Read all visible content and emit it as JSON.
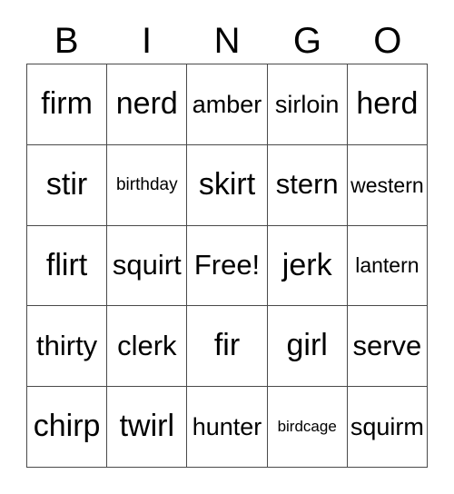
{
  "card": {
    "title": "BINGO",
    "header_letters": [
      "B",
      "I",
      "N",
      "G",
      "O"
    ],
    "free_space_label": "Free!",
    "colors": {
      "background": "#ffffff",
      "text": "#000000",
      "grid_line": "#4a4a4a"
    },
    "grid": {
      "columns": 5,
      "rows": 5,
      "cells": [
        [
          {
            "label": "firm",
            "size": "fs-xl"
          },
          {
            "label": "nerd",
            "size": "fs-xl"
          },
          {
            "label": "amber",
            "size": "fs-md"
          },
          {
            "label": "sirloin",
            "size": "fs-md"
          },
          {
            "label": "herd",
            "size": "fs-xl"
          }
        ],
        [
          {
            "label": "stir",
            "size": "fs-xl"
          },
          {
            "label": "birthday",
            "size": "fs-xs"
          },
          {
            "label": "skirt",
            "size": "fs-xl"
          },
          {
            "label": "stern",
            "size": "fs-lg"
          },
          {
            "label": "western",
            "size": "fs-sm"
          }
        ],
        [
          {
            "label": "flirt",
            "size": "fs-xl"
          },
          {
            "label": "squirt",
            "size": "fs-lg"
          },
          {
            "label": "Free!",
            "size": "fs-lg"
          },
          {
            "label": "jerk",
            "size": "fs-xl"
          },
          {
            "label": "lantern",
            "size": "fs-sm"
          }
        ],
        [
          {
            "label": "thirty",
            "size": "fs-lg"
          },
          {
            "label": "clerk",
            "size": "fs-lg"
          },
          {
            "label": "fir",
            "size": "fs-xl"
          },
          {
            "label": "girl",
            "size": "fs-xl"
          },
          {
            "label": "serve",
            "size": "fs-lg"
          }
        ],
        [
          {
            "label": "chirp",
            "size": "fs-xl"
          },
          {
            "label": "twirl",
            "size": "fs-xl"
          },
          {
            "label": "hunter",
            "size": "fs-md"
          },
          {
            "label": "birdcage",
            "size": "fs-xxs"
          },
          {
            "label": "squirm",
            "size": "fs-md"
          }
        ]
      ]
    }
  }
}
